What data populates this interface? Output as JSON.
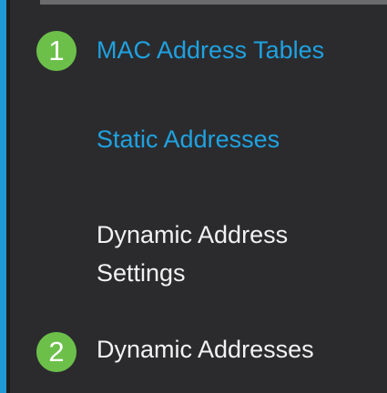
{
  "colors": {
    "background": "#2b2b2e",
    "accent_bar": "#1f9ad6",
    "link_text": "#1fa2e0",
    "plain_text": "#f2f2f2",
    "badge": "#6cc04a"
  },
  "menu": {
    "items": [
      {
        "label": "MAC Address Tables",
        "badge": "1",
        "style": "link"
      },
      {
        "label": "Static Addresses",
        "style": "link"
      },
      {
        "label": "Dynamic Address Settings",
        "style": "plain"
      },
      {
        "label": "Dynamic Addresses",
        "badge": "2",
        "style": "plain"
      }
    ]
  }
}
